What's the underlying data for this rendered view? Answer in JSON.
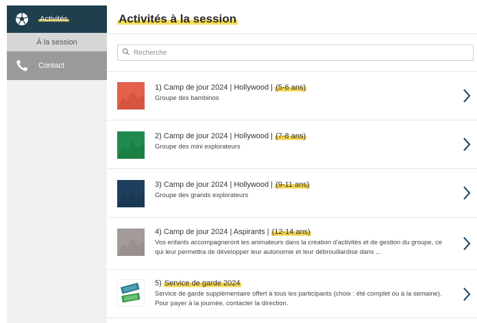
{
  "sidebar": {
    "items": [
      {
        "label": "Activités",
        "icon": "soccer-ball-icon"
      },
      {
        "label": "À la session"
      },
      {
        "label": "Contact",
        "icon": "phone-icon"
      }
    ]
  },
  "main": {
    "title": "Activités à la session",
    "search": {
      "placeholder": "Recherche"
    },
    "activities": [
      {
        "title_prefix": "1) Camp de jour 2024 | Hollywood | ",
        "title_age": "(5-6 ans)",
        "description": "Groupe des bambinos",
        "color": "#e2614a"
      },
      {
        "title_prefix": "2) Camp de jour 2024 | Hollywood | ",
        "title_age": "(7-8 ans)",
        "description": "Groupe des mini explorateurs",
        "color": "#1f8a4c"
      },
      {
        "title_prefix": "3) Camp de jour 2024 | Hollywood | ",
        "title_age": "(9-11 ans)",
        "description": "Groupe des grands explorateurs",
        "color": "#1f3f5f"
      },
      {
        "title_prefix": "4) Camp de jour 2024 | Aspirants | ",
        "title_age": "(12-14 ans)",
        "description": "Vos enfants accompagneront les animateurs dans la création d'activités et de gestion du groupe, ce qui leur permettra de développer leur autonomie et leur débrouillardise dans ...",
        "color": "#a39a9a"
      },
      {
        "title_prefix": "5) ",
        "title_age": "Service de garde 2024",
        "description": "Service de garde supplémentaire offert à tous les participants (choix : été complet ou à la semaine). Pour payer à la journée, contacter la direction.",
        "color": "#2a8a8a"
      }
    ]
  },
  "colors": {
    "sidebar_dark": "#1f3f4f",
    "highlight": "#f3d451",
    "chevron": "#1f4f6f"
  }
}
